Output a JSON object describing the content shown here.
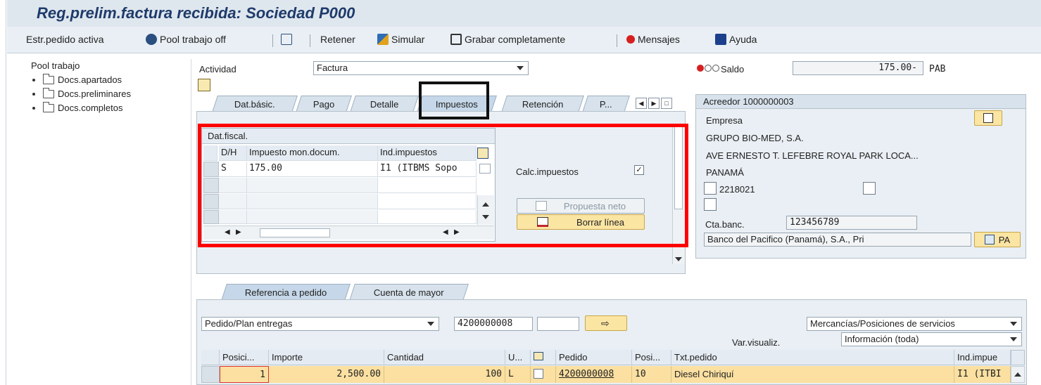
{
  "window": {
    "title": "Reg.prelim.factura recibida: Sociedad P000"
  },
  "toolbar": {
    "estr_pedido": "Estr.pedido activa",
    "pool_trabajo": "Pool trabajo off",
    "retener": "Retener",
    "simular": "Simular",
    "grabar": "Grabar completamente",
    "mensajes": "Mensajes",
    "ayuda": "Ayuda"
  },
  "pool": {
    "title": "Pool trabajo",
    "items": [
      "Docs.apartados",
      "Docs.preliminares",
      "Docs.completos"
    ]
  },
  "header": {
    "actividad_label": "Actividad",
    "actividad_value": "Factura",
    "saldo_label": "Saldo",
    "saldo_value": "175.00-",
    "saldo_currency": "PAB"
  },
  "tabs": {
    "items": [
      "Dat.básic.",
      "Pago",
      "Detalle",
      "Impuestos",
      "Retención",
      "P..."
    ],
    "active": "Impuestos"
  },
  "tax_grid": {
    "title": "Dat.fiscal.",
    "columns": [
      "D/H",
      "Impuesto mon.docum.",
      "Ind.impuestos"
    ],
    "rows": [
      {
        "dh": "S",
        "amount": "175.00",
        "indicator": "I1 (ITBMS Sopo"
      }
    ]
  },
  "tax_options": {
    "calc_label": "Calc.impuestos",
    "calc_checked": true,
    "propuesta_neto": "Propuesta neto",
    "borrar_linea": "Borrar línea"
  },
  "vendor": {
    "title": "Acreedor 1000000003",
    "empresa": "Empresa",
    "name": "GRUPO BIO-MED, S.A.",
    "address": "AVE ERNESTO T. LEFEBRE ROYAL PARK LOCA...",
    "country": "PANAMÁ",
    "phone": "2218021",
    "cta_banc_label": "Cta.banc.",
    "cta_banc_value": "123456789",
    "bank": "Banco del Pacifico (Panamá), S.A., Pri",
    "bank_country": "PA"
  },
  "bottom": {
    "tabs": [
      "Referencia a pedido",
      "Cuenta de mayor"
    ],
    "ref_type": "Pedido/Plan entregas",
    "pedido_no": "4200000008",
    "pedido_extra": "",
    "mercancias": "Mercancías/Posiciones de servicios",
    "var_visualiz_label": "Var.visualiz.",
    "var_visualiz_value": "Información (toda)",
    "columns": [
      "Posici...",
      "Importe",
      "Cantidad",
      "U...",
      "",
      "Pedido",
      "Posi...",
      "Txt.pedido",
      "Ind.impue"
    ],
    "rows": [
      {
        "posicion": "1",
        "importe": "2,500.00",
        "cantidad": "100",
        "unidad": "L",
        "pedido": "4200000008",
        "posi": "10",
        "txt": "Diesel Chiriquí",
        "ind": "I1 (ITBI"
      }
    ]
  },
  "colors": {
    "title_bg": "#dfe7ee",
    "highlight_red": "#ff0000",
    "row_selected": "#fbe0a1"
  }
}
